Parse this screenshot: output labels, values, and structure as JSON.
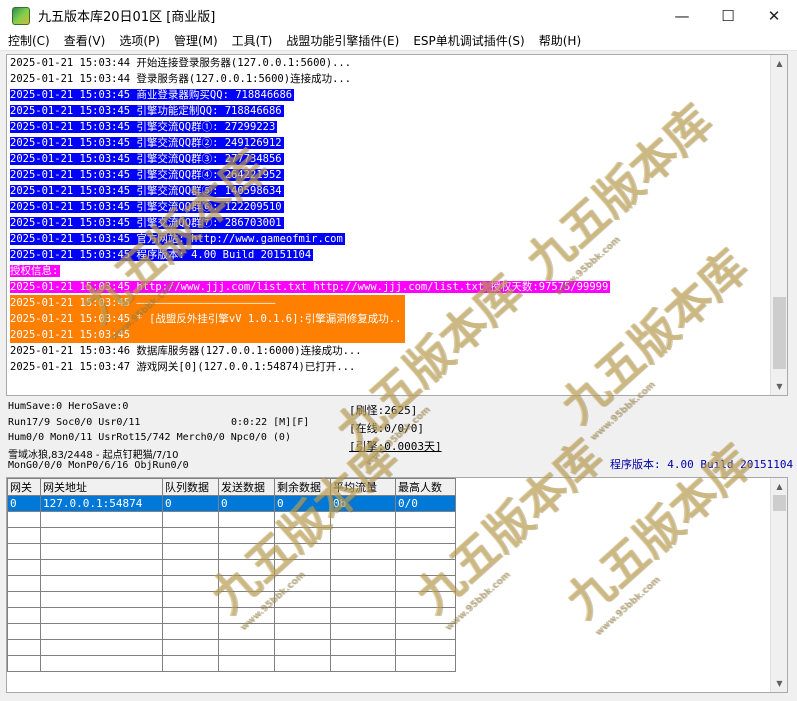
{
  "window": {
    "title": "九五版本库20日01区 [商业版]",
    "buttons": {
      "minimize": "—",
      "maximize": "☐",
      "close": "✕"
    }
  },
  "menu": [
    "控制(C)",
    "查看(V)",
    "选项(P)",
    "管理(M)",
    "工具(T)",
    "战盟功能引擎插件(E)",
    "ESP单机调试插件(S)",
    "帮助(H)"
  ],
  "log": [
    {
      "text": "2025-01-21 15:03:44 开始连接登录服务器(127.0.0.1:5600)...",
      "style": "normal"
    },
    {
      "text": "2025-01-21 15:03:44 登录服务器(127.0.0.1:5600)连接成功...",
      "style": "normal"
    },
    {
      "text": "2025-01-21 15:03:45 商业登录器购买QQ: 718846686",
      "style": "blue"
    },
    {
      "text": "2025-01-21 15:03:45 引擎功能定制QQ: 718846686",
      "style": "blue"
    },
    {
      "text": "2025-01-21 15:03:45 引擎交流QQ群①: 27299223",
      "style": "blue"
    },
    {
      "text": "2025-01-21 15:03:45 引擎交流QQ群②: 249126912",
      "style": "blue"
    },
    {
      "text": "2025-01-21 15:03:45 引擎交流QQ群③: 277734856",
      "style": "blue"
    },
    {
      "text": "2025-01-21 15:03:45 引擎交流QQ群④: 264221952",
      "style": "blue"
    },
    {
      "text": "2025-01-21 15:03:45 引擎交流QQ群⑤: 140598634",
      "style": "blue"
    },
    {
      "text": "2025-01-21 15:03:45 引擎交流QQ群⑥: 122209510",
      "style": "blue"
    },
    {
      "text": "2025-01-21 15:03:45 引擎交流QQ群⑦: 286703001",
      "style": "blue"
    },
    {
      "text": "2025-01-21 15:03:45 官方网站: http://www.gameofmir.com",
      "style": "blue"
    },
    {
      "text": "2025-01-21 15:03:45 程序版本: 4.00 Build 20151104",
      "style": "blue"
    },
    {
      "text": "授权信息:",
      "style": "magenta"
    },
    {
      "text": "2025-01-21 15:03:45 http://www.jjj.com/list.txt http://www.jjj.com/list.txt 授权天数:97575/99999",
      "style": "magenta"
    },
    {
      "text": "2025-01-21 15:03:45 ——————————————————————",
      "style": "orange-wide"
    },
    {
      "text": "2025-01-21 15:03:45 * [战盟反外挂引擎vV 1.0.1.6]:引擎漏洞修复成功..",
      "style": "orange-wide"
    },
    {
      "text": "2025-01-21 15:03:45",
      "style": "orange-wide"
    },
    {
      "text": "2025-01-21 15:03:46 数据库服务器(127.0.0.1:6000)连接成功...",
      "style": "normal"
    },
    {
      "text": "2025-01-21 15:03:47 游戏网关[0](127.0.0.1:54874)已打开...",
      "style": "normal"
    }
  ],
  "status": {
    "line1": "HumSave:0 HeroSave:0",
    "line2": "Run17/9 Soc0/0 Usr0/11",
    "time": "0:0:22 [M][F]",
    "line3": "Hum0/0 Mon0/11 UsrRot15/742 Merch0/0 Npc0/0 (0)",
    "line4": "雪域冰狼,83/2448 - 起点钉耙猫/7/10",
    "line5": "MonG0/0/0 MonP0/6/16 ObjRun0/0",
    "refresh": "[刷怪:2625]",
    "online": "[在线:0/0/0]",
    "engine": "[引擎:0.0003天]",
    "version": "程序版本: 4.00 Build 20151104"
  },
  "table": {
    "headers": [
      "网关",
      "网关地址",
      "队列数据",
      "发送数据",
      "剩余数据",
      "平均流量",
      "最高人数"
    ],
    "rows": [
      [
        "0",
        "127.0.0.1:54874",
        "0",
        "0",
        "0",
        "0b",
        "0/0"
      ]
    ]
  },
  "watermark": {
    "text": "九五版本库",
    "sub": "www.95bbk.com"
  },
  "colors": {
    "highlight_blue": "#0000ff",
    "highlight_magenta": "#ff00ff",
    "highlight_orange": "#ff7f00",
    "selected_row": "#0078d7",
    "version_text": "#0000aa"
  }
}
